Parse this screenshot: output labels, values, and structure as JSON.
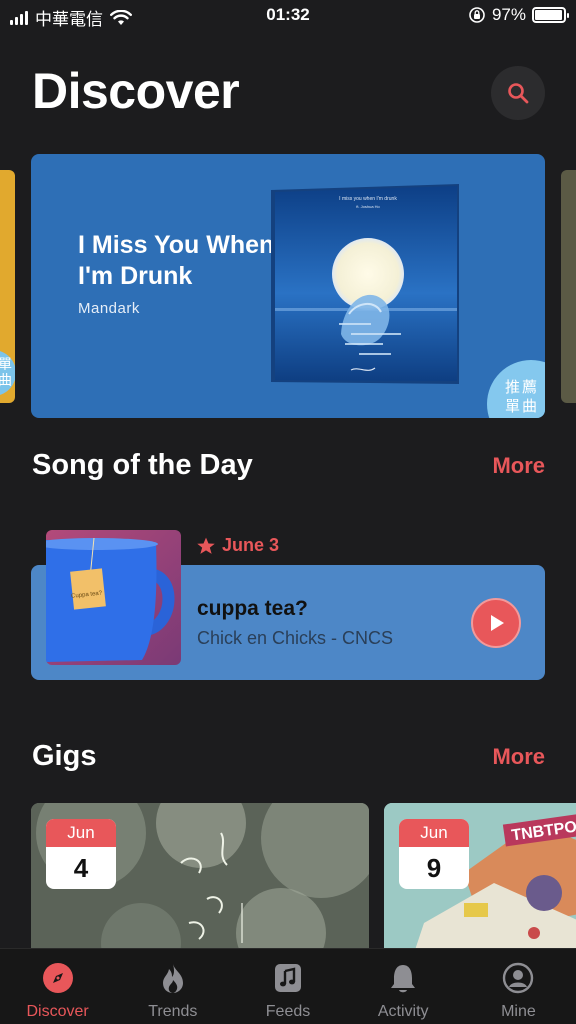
{
  "status_bar": {
    "carrier": "中華電信",
    "time": "01:32",
    "battery": "97%",
    "battery_level": 0.97
  },
  "header": {
    "title": "Discover",
    "search_icon": "search-icon"
  },
  "featured": {
    "title": "I Miss You When I'm Drunk",
    "artist": "Mandark",
    "badge": "推薦單曲",
    "left_peek_badge": "推薦單曲",
    "album_text_line1": "I miss you when I'm drunk",
    "album_text_line2": "ft. Joshua Ho",
    "colors": {
      "card": "#2e6fb6",
      "badge": "#84c8ee"
    }
  },
  "song_of_day": {
    "section_title": "Song of the Day",
    "more": "More",
    "date": "June 3",
    "song": "cuppa tea?",
    "artist": "Chick en Chicks - CNCS",
    "tea_tag": "Cuppa tea?",
    "icons": {
      "date": "star-icon",
      "play": "play-icon"
    }
  },
  "gigs": {
    "section_title": "Gigs",
    "more": "More",
    "items": [
      {
        "month": "Jun",
        "day": "4"
      },
      {
        "month": "Jun",
        "day": "9",
        "poster_text": "TNBTPO"
      }
    ]
  },
  "tab_bar": {
    "tabs": [
      {
        "label": "Discover",
        "icon": "compass-icon",
        "active": true
      },
      {
        "label": "Trends",
        "icon": "flame-icon",
        "active": false
      },
      {
        "label": "Feeds",
        "icon": "music-note-icon",
        "active": false
      },
      {
        "label": "Activity",
        "icon": "bell-icon",
        "active": false
      },
      {
        "label": "Mine",
        "icon": "user-icon",
        "active": false
      }
    ]
  },
  "colors": {
    "accent": "#e8575a",
    "background": "#1c1c1e"
  }
}
